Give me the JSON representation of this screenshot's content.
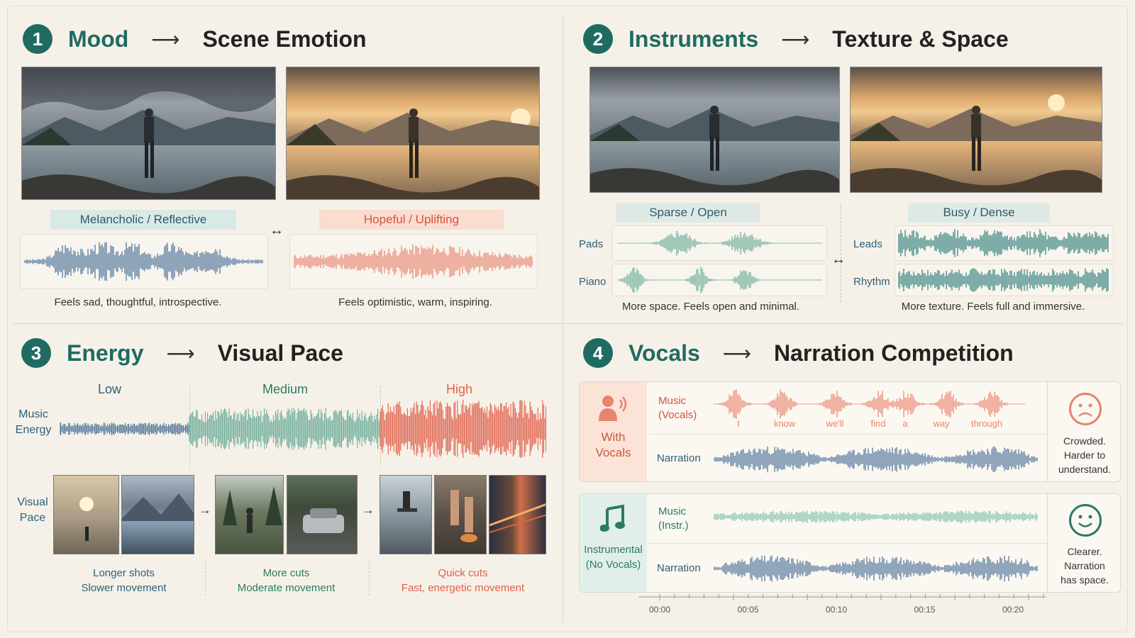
{
  "colors": {
    "teal": "#1f6b61",
    "blue": "#4a6f96",
    "coral": "#e8836d",
    "green": "#6aab98",
    "red": "#e0604a"
  },
  "mood": {
    "number": "1",
    "title": "Mood",
    "subtitle": "Scene Emotion",
    "left": {
      "label": "Melancholic / Reflective",
      "caption": "Feels sad, thoughtful, introspective."
    },
    "right": {
      "label": "Hopeful / Uplifting",
      "caption": "Feels optimistic, warm, inspiring."
    },
    "between": "↔"
  },
  "instruments": {
    "number": "2",
    "title": "Instruments",
    "subtitle": "Texture & Space",
    "left": {
      "label": "Sparse / Open",
      "tracks": [
        "Pads",
        "Piano"
      ],
      "caption": "More space. Feels open and minimal."
    },
    "right": {
      "label": "Busy / Dense",
      "tracks": [
        "Leads",
        "Rhythm"
      ],
      "caption": "More texture. Feels full and immersive."
    },
    "between": "↔"
  },
  "energy": {
    "number": "3",
    "title": "Energy",
    "subtitle": "Visual Pace",
    "row_music": "Music Energy",
    "row_visual": "Visual Pace",
    "levels": [
      "Low",
      "Medium",
      "High"
    ],
    "captions": [
      {
        "line1": "Longer shots",
        "line2": "Slower movement"
      },
      {
        "line1": "More cuts",
        "line2": "Moderate movement"
      },
      {
        "line1": "Quick cuts",
        "line2": "Fast, energetic movement"
      }
    ]
  },
  "vocals": {
    "number": "4",
    "title": "Vocals",
    "subtitle": "Narration Competition",
    "with": {
      "label_1": "With",
      "label_2": "Vocals",
      "music_1": "Music",
      "music_2": "(Vocals)",
      "narration": "Narration",
      "words": [
        "I",
        "know",
        "we'll",
        "find",
        "a",
        "way",
        "through"
      ],
      "verdict_1": "Crowded.",
      "verdict_2": "Harder to",
      "verdict_3": "understand."
    },
    "without": {
      "label_1": "Instrumental",
      "label_2": "(No Vocals)",
      "music_1": "Music",
      "music_2": "(Instr.)",
      "narration": "Narration",
      "verdict_1": "Clearer.",
      "verdict_2": "Narration",
      "verdict_3": "has space."
    },
    "time_ticks": [
      "00:00",
      "00:05",
      "00:10",
      "00:15",
      "00:20"
    ]
  }
}
